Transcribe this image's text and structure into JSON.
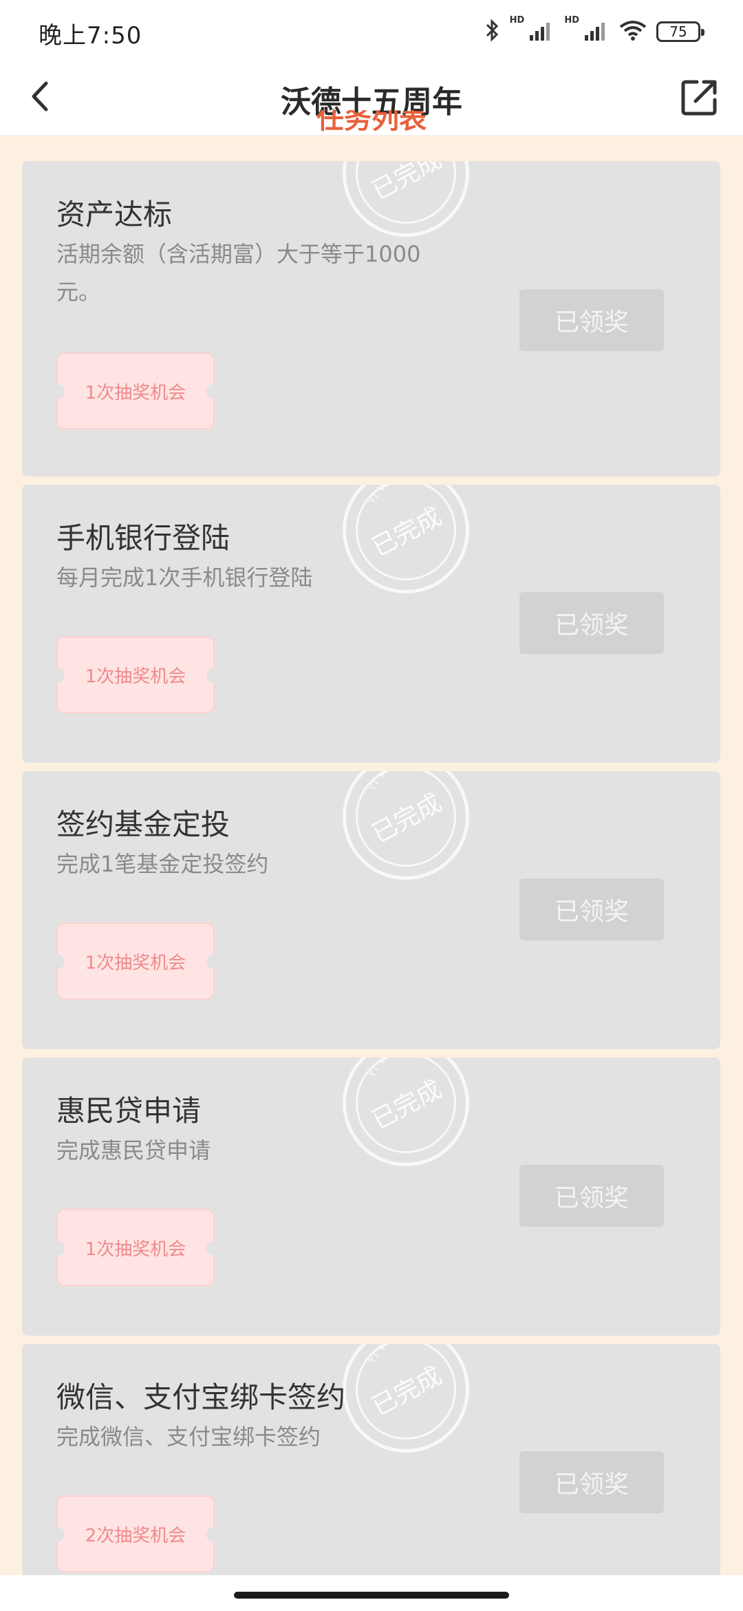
{
  "status_bar": {
    "time": "晚上7:50",
    "hd1": "HD",
    "hd2": "HD",
    "battery": "75"
  },
  "header": {
    "title": "沃德十五周年"
  },
  "section_heading_partial": "任务列表",
  "stamp": {
    "text": "已完成",
    "arc": "YI WA"
  },
  "tasks": [
    {
      "title": "资产达标",
      "description": "活期余额（含活期富）大于等于1000元。",
      "reward": "1次抽奖机会",
      "button": "已领奖"
    },
    {
      "title": "手机银行登陆",
      "description": "每月完成1次手机银行登陆",
      "reward": "1次抽奖机会",
      "button": "已领奖"
    },
    {
      "title": "签约基金定投",
      "description": "完成1笔基金定投签约",
      "reward": "1次抽奖机会",
      "button": "已领奖"
    },
    {
      "title": "惠民贷申请",
      "description": "完成惠民贷申请",
      "reward": "1次抽奖机会",
      "button": "已领奖"
    },
    {
      "title": "微信、支付宝绑卡签约",
      "description": "完成微信、支付宝绑卡签约",
      "reward": "2次抽奖机会",
      "button": "已领奖"
    }
  ],
  "colors": {
    "page_bg": "#fdf0e0",
    "card_bg": "#e3e2e2",
    "ticket_bg": "#ffe4e4",
    "ticket_text": "#ef8a8a",
    "accent": "#e8603a"
  }
}
